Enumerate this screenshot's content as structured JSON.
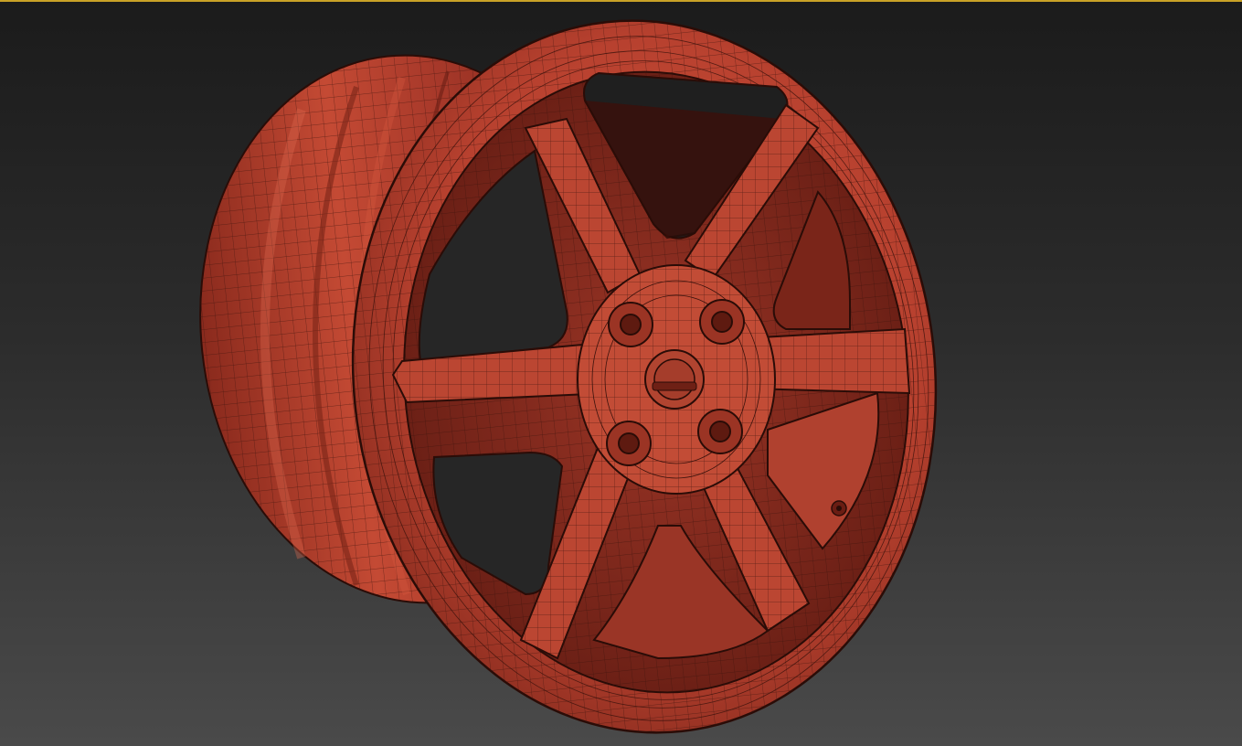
{
  "viewport": {
    "active_border_color": "#c9a227",
    "background_top": "#1b1b1b",
    "background_bottom": "#4a4a4a",
    "object_color": "#b8412f",
    "wire_color": "#3a120c",
    "display_mode": "wireframe-on-shaded"
  },
  "model": {
    "type": "car-wheel-rim",
    "spoke_count": 6,
    "lug_nut_count": 4,
    "valve_stem": true
  }
}
